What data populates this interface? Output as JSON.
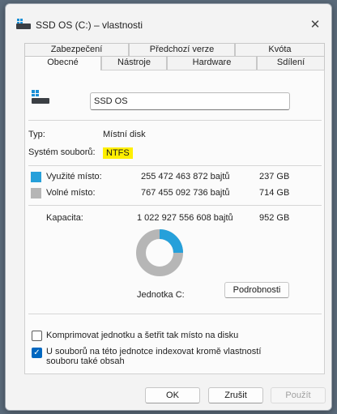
{
  "window": {
    "title": "SSD OS (C:) – vlastnosti",
    "close_glyph": "✕"
  },
  "tabs": {
    "row1": [
      "Zabezpečení",
      "Předchozí verze",
      "Kvóta"
    ],
    "row2": [
      "Obecné",
      "Nástroje",
      "Hardware",
      "Sdílení"
    ],
    "active": "Obecné"
  },
  "general": {
    "drive_name": "SSD OS",
    "type_label": "Typ:",
    "type_value": "Místní disk",
    "fs_label": "Systém souborů:",
    "fs_value": "NTFS",
    "used_label": "Využité místo:",
    "used_bytes": "255 472 463 872 bajtů",
    "used_size": "237 GB",
    "free_label": "Volné místo:",
    "free_bytes": "767 455 092 736 bajtů",
    "free_size": "714 GB",
    "capacity_label": "Kapacita:",
    "capacity_bytes": "1 022 927 556 608 bajtů",
    "capacity_size": "952 GB",
    "drive_label": "Jednotka C:",
    "details_button": "Podrobnosti",
    "used_fraction": 0.2497
  },
  "options": {
    "compress_label": "Komprimovat jednotku a šetřit tak místo na disku",
    "compress_checked": false,
    "index_label_line1": "U souborů na této jednotce indexovat kromě vlastností",
    "index_label_line2": "souboru také obsah",
    "index_checked": true
  },
  "footer": {
    "ok": "OK",
    "cancel": "Zrušit",
    "apply": "Použít"
  },
  "colors": {
    "used": "#26a0da",
    "free": "#b6b6b6",
    "highlight": "#ffef00",
    "accent": "#0067c0"
  },
  "icons": {
    "drive": "drive-icon",
    "close": "close-icon",
    "check": "checkmark-icon"
  }
}
